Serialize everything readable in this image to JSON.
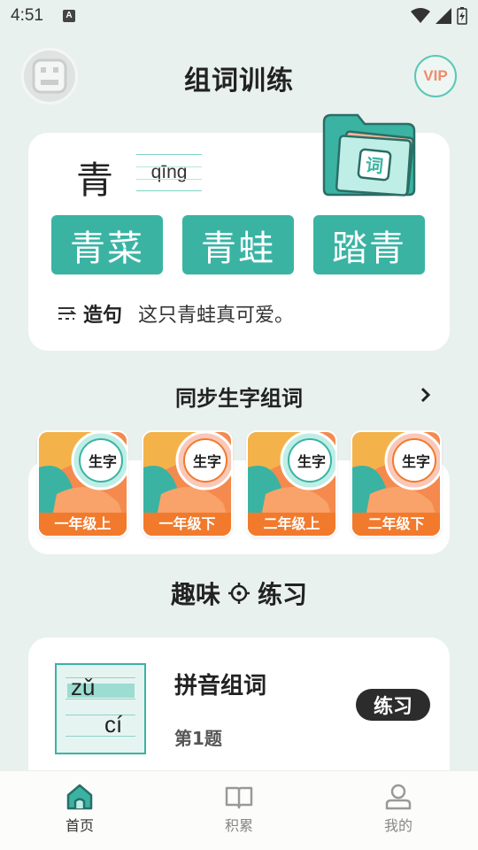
{
  "status_bar": {
    "time": "4:51",
    "notification_icon": "A"
  },
  "header": {
    "title": "组词训练",
    "vip_label": "VIP"
  },
  "word_card": {
    "character": "青",
    "pinyin": "qīng",
    "words": [
      "青菜",
      "青蛙",
      "踏青"
    ],
    "sentence_label": "造句",
    "sentence": "这只青蛙真可爱。",
    "folder_glyph": "词"
  },
  "sync_section": {
    "title": "同步生字组词",
    "seal_label": "生字",
    "grades": [
      "一年级上",
      "一年级下",
      "二年级上",
      "二年级下"
    ]
  },
  "fun_section": {
    "title_left": "趣味",
    "title_right": "练习"
  },
  "practice": {
    "thumb_line1": "zǔ",
    "thumb_line2": "cí",
    "name": "拼音组词",
    "subtitle": "第1题",
    "button_label": "练习"
  },
  "bottom_nav": [
    {
      "label": "首页",
      "icon": "home-icon",
      "active": true
    },
    {
      "label": "积累",
      "icon": "book-icon",
      "active": false
    },
    {
      "label": "我的",
      "icon": "person-icon",
      "active": false
    }
  ],
  "colors": {
    "accent": "#3ab3a3",
    "orange": "#f27a2c",
    "background": "#e9f1ee"
  }
}
